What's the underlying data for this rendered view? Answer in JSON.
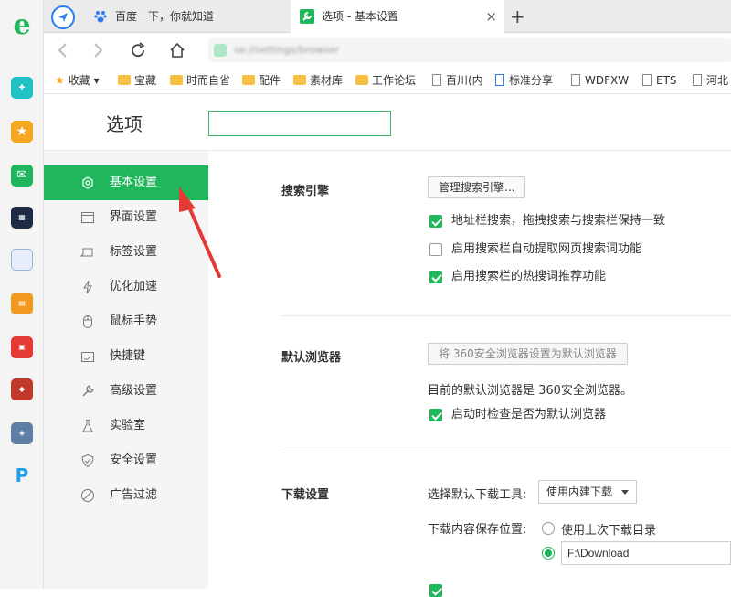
{
  "tabs": [
    {
      "label": "百度一下，你就知道"
    },
    {
      "label": "选项 - 基本设置"
    }
  ],
  "tab_close_glyph": "×",
  "new_tab_glyph": "+",
  "address": {
    "url": "se://settings/browser"
  },
  "bookmarks": [
    {
      "label": "收藏",
      "type": "star"
    },
    {
      "label": "宝藏",
      "type": "folder"
    },
    {
      "label": "时而自省",
      "type": "folder"
    },
    {
      "label": "配件",
      "type": "folder"
    },
    {
      "label": "素材库",
      "type": "folder"
    },
    {
      "label": "工作论坛",
      "type": "folder"
    },
    {
      "label": "百川(内",
      "type": "page"
    },
    {
      "label": "标准分享",
      "type": "page"
    },
    {
      "label": "WDFXW",
      "type": "page"
    },
    {
      "label": "ETS",
      "type": "page"
    },
    {
      "label": "河北",
      "type": "page"
    }
  ],
  "page": {
    "title": "选项",
    "search_value": ""
  },
  "sidebar": {
    "items": [
      {
        "label": "基本设置",
        "icon": "gear-icon",
        "active": true
      },
      {
        "label": "界面设置",
        "icon": "window-icon"
      },
      {
        "label": "标签设置",
        "icon": "tab-icon"
      },
      {
        "label": "优化加速",
        "icon": "lightning-icon"
      },
      {
        "label": "鼠标手势",
        "icon": "mouse-icon"
      },
      {
        "label": "快捷键",
        "icon": "keyboard-icon"
      },
      {
        "label": "高级设置",
        "icon": "wrench-icon"
      },
      {
        "label": "实验室",
        "icon": "flask-icon"
      },
      {
        "label": "安全设置",
        "icon": "shield-icon"
      },
      {
        "label": "广告过滤",
        "icon": "block-icon"
      }
    ]
  },
  "search_engine": {
    "title": "搜索引擎",
    "manage_button": "管理搜索引擎...",
    "options": [
      {
        "label": "地址栏搜索，拖拽搜索与搜索栏保持一致",
        "checked": true
      },
      {
        "label": "启用搜索栏自动提取网页搜索词功能",
        "checked": false
      },
      {
        "label": "启用搜索栏的热搜词推荐功能",
        "checked": true
      }
    ]
  },
  "default_browser": {
    "title": "默认浏览器",
    "set_button": "将 360安全浏览器设置为默认浏览器",
    "status": "目前的默认浏览器是 360安全浏览器。",
    "check_option": {
      "label": "启动时检查是否为默认浏览器",
      "checked": true
    }
  },
  "download": {
    "title": "下载设置",
    "tool_label": "选择默认下载工具:",
    "tool_value": "使用内建下载",
    "location_label": "下载内容保存位置:",
    "option_last_dir": "使用上次下载目录",
    "path_value": "F:\\Download"
  },
  "colors": {
    "accent": "#20b65b",
    "tab_icon": "#2e7ef2"
  }
}
